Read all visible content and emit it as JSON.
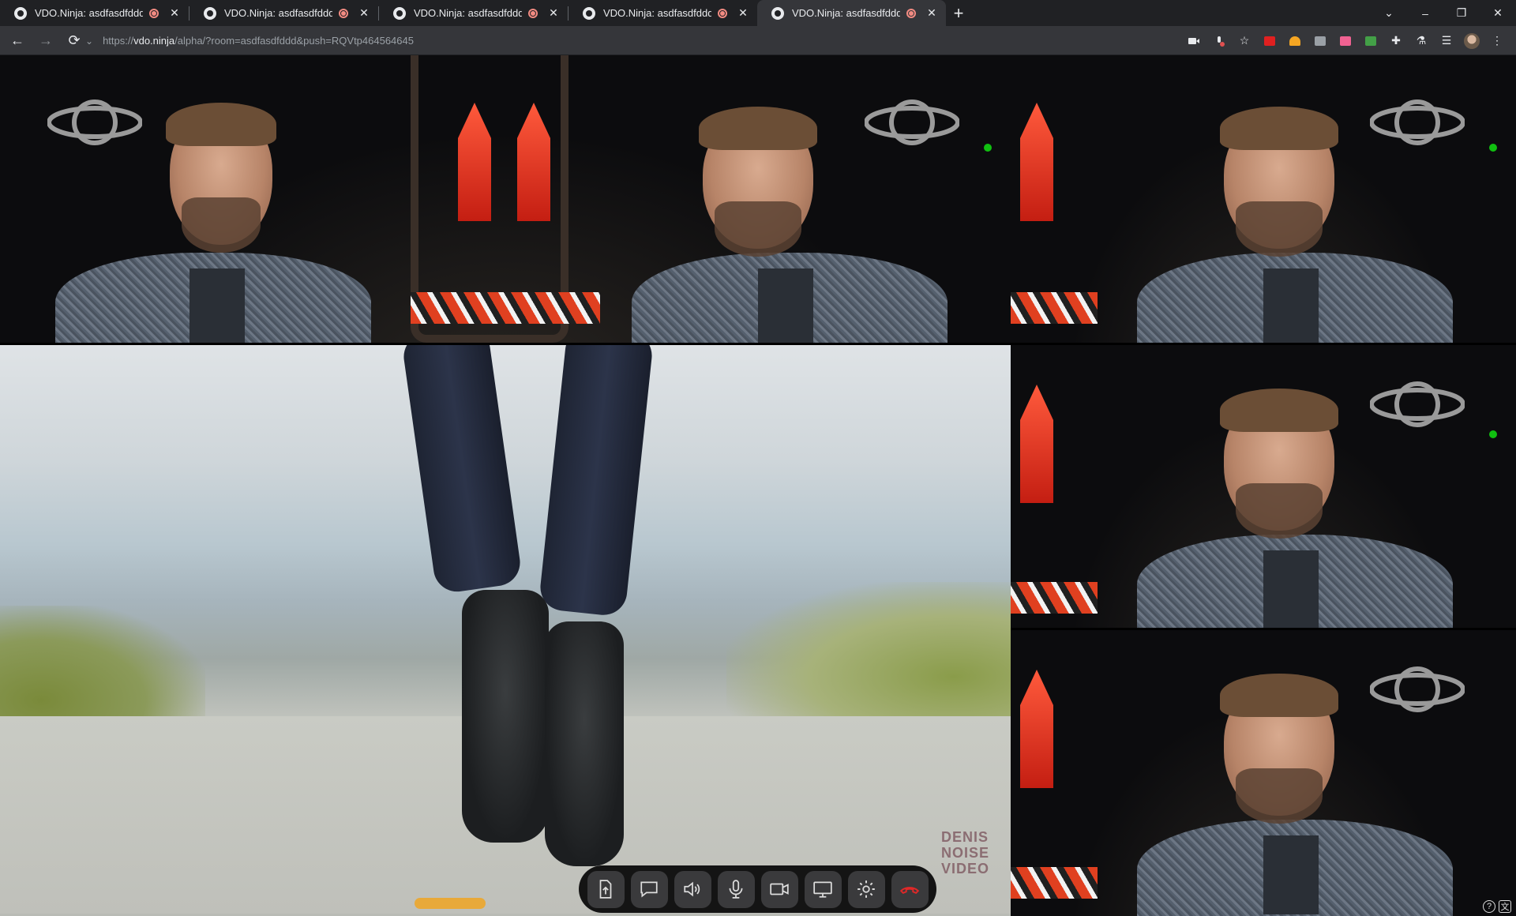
{
  "browser": {
    "tabs": [
      {
        "title": "VDO.Ninja: asdfasdfddd",
        "active": false
      },
      {
        "title": "VDO.Ninja: asdfasdfddd",
        "active": false
      },
      {
        "title": "VDO.Ninja: asdfasdfddd",
        "active": false
      },
      {
        "title": "VDO.Ninja: asdfasdfddd",
        "active": false
      },
      {
        "title": "VDO.Ninja: asdfasdfddd",
        "active": true
      }
    ],
    "new_tab": "+",
    "window_controls": {
      "menu": "⌄",
      "minimize": "–",
      "restore": "❐",
      "close": "✕"
    },
    "nav": {
      "back": "←",
      "forward": "→",
      "reload": "⟳"
    },
    "url": {
      "prefix": "https://",
      "host": "vdo.ninja",
      "path": "/alpha/?room=asdfasdfddd&push=RQVtp464564645"
    }
  },
  "tabs_close_glyph": "✕",
  "video_grid": {
    "tiles": [
      {
        "name": "main-guest-top",
        "kind": "studio"
      },
      {
        "name": "guest-right-1",
        "kind": "studio"
      },
      {
        "name": "boots-video",
        "kind": "video"
      },
      {
        "name": "guest-right-2",
        "kind": "studio"
      },
      {
        "name": "guest-right-3",
        "kind": "studio"
      }
    ],
    "watermark": "DENIS\nNOISE\nVIDEO"
  },
  "controls": {
    "items": [
      "share-file-icon",
      "chat-icon",
      "speaker-icon",
      "microphone-icon",
      "camera-icon",
      "screen-share-icon",
      "settings-icon",
      "hangup-icon"
    ],
    "hangup_color": "#e02828"
  },
  "corner": {
    "help": "?",
    "lang": "文"
  }
}
